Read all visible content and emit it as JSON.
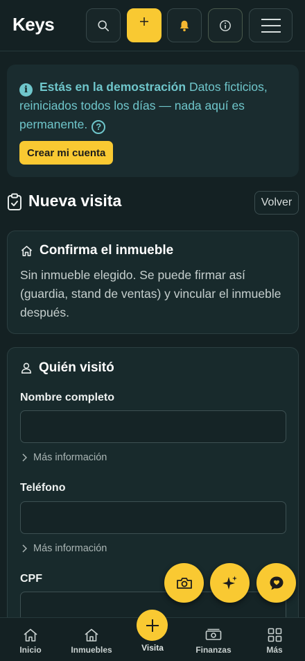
{
  "app": {
    "brand": "Keys"
  },
  "header": {
    "buttons": [
      {
        "name": "search",
        "icon": "search-icon"
      },
      {
        "name": "add",
        "icon": "plus-icon",
        "accent": "#f9c932"
      },
      {
        "name": "notifications",
        "icon": "bell-icon"
      },
      {
        "name": "info",
        "icon": "info-icon"
      },
      {
        "name": "menu",
        "icon": "hamburger-icon"
      }
    ]
  },
  "banner": {
    "title": "Estás en la demostración",
    "text": "Datos ficticios, reiniciados todos los días — nada aquí es permanente.",
    "cta": "Crear mi cuenta",
    "icon": "info-icon",
    "help_icon": "help-icon",
    "color": "#6fc6cb"
  },
  "page": {
    "title": "Nueva visita",
    "back_label": "Volver",
    "icon": "clipboard-check-icon"
  },
  "property_card": {
    "title": "Confirma el inmueble",
    "icon": "home-icon",
    "body": "Sin inmueble elegido. Se puede firmar así (guardia, stand de ventas) y vincular el inmueble después."
  },
  "visitor_card": {
    "title": "Quién visitó",
    "icon": "user-icon",
    "fields": [
      {
        "label": "Nombre completo",
        "value": "",
        "more": "Más información"
      },
      {
        "label": "Teléfono",
        "value": "",
        "more": "Más información"
      },
      {
        "label": "CPF",
        "value": ""
      }
    ]
  },
  "fabs": [
    {
      "name": "camera",
      "icon": "camera-icon"
    },
    {
      "name": "ai",
      "icon": "sparkles-icon"
    },
    {
      "name": "chat",
      "icon": "chat-heart-icon"
    }
  ],
  "bottom_nav": {
    "items": [
      {
        "label": "Inicio",
        "icon": "home-icon"
      },
      {
        "label": "Inmuebles",
        "icon": "buildings-icon"
      },
      {
        "label": "Visita",
        "icon": "plus-icon"
      },
      {
        "label": "Finanzas",
        "icon": "money-icon"
      },
      {
        "label": "Más",
        "icon": "grid-icon"
      }
    ]
  },
  "colors": {
    "background": "#142123",
    "accent": "#f9c932",
    "card": "#182a2c"
  }
}
